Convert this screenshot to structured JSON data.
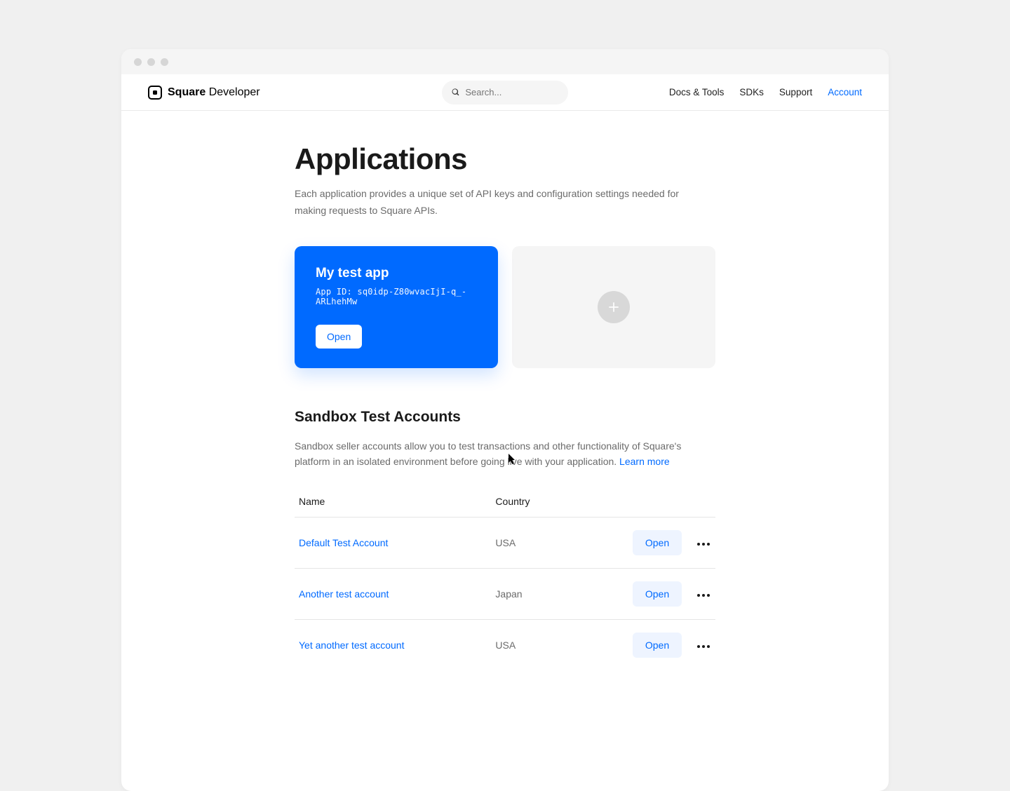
{
  "logo": {
    "brand": "Square",
    "sub": "Developer"
  },
  "search": {
    "placeholder": "Search..."
  },
  "nav": {
    "items": [
      {
        "label": "Docs & Tools",
        "active": false
      },
      {
        "label": "SDKs",
        "active": false
      },
      {
        "label": "Support",
        "active": false
      },
      {
        "label": "Account",
        "active": true
      }
    ]
  },
  "page": {
    "title": "Applications",
    "description": "Each application provides a unique set of API keys and configuration settings needed for making requests to Square APIs."
  },
  "app_card": {
    "name": "My test app",
    "app_id_label": "App ID: sq0idp-Z80wvacIjI-q_-ARLhehMw",
    "open_label": "Open"
  },
  "sandbox": {
    "title": "Sandbox Test Accounts",
    "description": "Sandbox seller accounts allow you to test transactions and other functionality of Square's platform in an isolated environment before going live with your application. ",
    "learn_more": "Learn more",
    "columns": {
      "name": "Name",
      "country": "Country"
    },
    "open_label": "Open",
    "accounts": [
      {
        "name": "Default Test Account",
        "country": "USA"
      },
      {
        "name": "Another test account",
        "country": "Japan"
      },
      {
        "name": "Yet another test account",
        "country": "USA"
      }
    ]
  }
}
